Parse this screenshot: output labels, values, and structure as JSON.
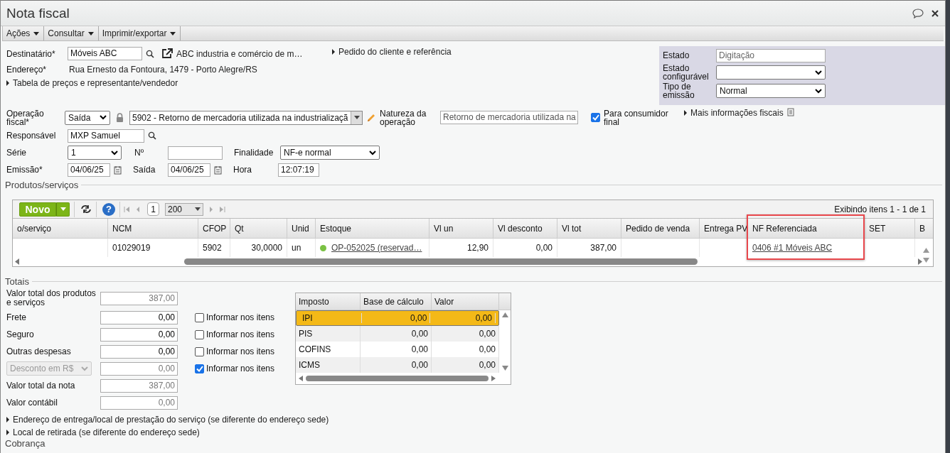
{
  "window": {
    "title": "Nota fiscal"
  },
  "menu": [
    {
      "label": "Ações"
    },
    {
      "label": "Consultar"
    },
    {
      "label": "Imprimir/exportar"
    }
  ],
  "destinatario": {
    "label": "Destinatário*",
    "value": "Móveis ABC",
    "company": "ABC industria e comércio de m…"
  },
  "endereco": {
    "label": "Endereço*",
    "value": "Rua Ernesto da Fontoura, 1479 - Porto Alegre/RS"
  },
  "expanders_top": [
    {
      "label": "Pedido do cliente e referência",
      "expanded": false
    },
    {
      "label": "Tabela de preços e representante/vendedor",
      "expanded": false
    }
  ],
  "status_panel": [
    {
      "label": "Estado",
      "kind": "readonly",
      "value": "Digitação"
    },
    {
      "label": "Estado configurável",
      "kind": "select"
    },
    {
      "label": "Tipo de emissão",
      "kind": "select",
      "value": "Normal"
    }
  ],
  "operacao": {
    "label": "Operação fiscal*",
    "direction": "Saída",
    "locked": true,
    "cfop": "5902 - Retorno de mercadoria utilizada na industrializaçã"
  },
  "natureza": {
    "label": "Natureza da operação",
    "value": "Retorno de mercadoria utilizada na"
  },
  "consumidor_final": {
    "label": "Para consumidor final",
    "checked": true
  },
  "mais_info": {
    "label": "Mais informações fiscais",
    "expanded": false
  },
  "responsavel": {
    "label": "Responsável",
    "value": "MXP Samuel"
  },
  "serie": {
    "label": "Série",
    "value": "1"
  },
  "numero": {
    "label": "Nº"
  },
  "finalidade": {
    "label": "Finalidade",
    "value": "NF-e normal"
  },
  "emissao": {
    "label": "Emissão*",
    "value": "04/06/25"
  },
  "saida": {
    "label": "Saída",
    "value": "04/06/25"
  },
  "hora": {
    "label": "Hora",
    "value": "12:07:19"
  },
  "produtos": {
    "title": "Produtos/serviços",
    "new_button": "Novo",
    "help_glyph": "?",
    "page": "1",
    "page_size": "200",
    "status": "Exibindo itens 1 - 1 de 1",
    "columns": [
      {
        "label": "o/serviço"
      },
      {
        "label": "NCM"
      },
      {
        "label": "CFOP"
      },
      {
        "label": "Qt"
      },
      {
        "label": "Unid"
      },
      {
        "label": "Estoque"
      },
      {
        "label": "Vl un"
      },
      {
        "label": "Vl desconto"
      },
      {
        "label": "Vl tot"
      },
      {
        "label": "Pedido de venda"
      },
      {
        "label": "Entrega PV"
      },
      {
        "label": "NF Referenciada",
        "highlighted": true
      },
      {
        "label": "SET"
      },
      {
        "label": "B"
      }
    ],
    "rows": [
      [
        null,
        {
          "text": "01029019"
        },
        {
          "text": "5902"
        },
        {
          "text": "30,0000"
        },
        {
          "text": "un"
        },
        {
          "text": "OP-052025 (reservad…",
          "link": true,
          "color": "#7ac143"
        },
        {
          "text": "12,90"
        },
        {
          "text": "0,00"
        },
        {
          "text": "387,00"
        },
        null,
        null,
        {
          "text": "0406 #1 Móveis ABC",
          "link": true
        },
        null,
        null
      ]
    ]
  },
  "totais": {
    "title": "Totais",
    "items": [
      {
        "label": "Valor total dos produtos e serviços",
        "value": "387,00",
        "readonly": true
      },
      {
        "label": "Frete",
        "value": "0,00",
        "readonly": false,
        "informar": {
          "label": "Informar nos itens",
          "checked": false
        }
      },
      {
        "label": "Seguro",
        "value": "0,00",
        "readonly": false,
        "informar": {
          "label": "Informar nos itens",
          "checked": false
        }
      },
      {
        "label": "Outras despesas",
        "value": "0,00",
        "readonly": false,
        "informar": {
          "label": "Informar nos itens",
          "checked": false
        }
      },
      {
        "label": "Desconto em R$",
        "kind": "select",
        "value": "0,00",
        "readonly": true,
        "informar": {
          "label": "Informar nos itens",
          "checked": true
        }
      },
      {
        "label": "Valor total da nota",
        "value": "387,00",
        "readonly": true
      },
      {
        "label": "Valor contábil",
        "value": "0,00",
        "readonly": true
      }
    ],
    "tax_columns": [
      "Imposto",
      "Base de cálculo",
      "Valor"
    ],
    "taxes": [
      {
        "name": "IPI",
        "base": "0,00",
        "value": "0,00",
        "selected": true
      },
      {
        "name": "PIS",
        "base": "0,00",
        "value": "0,00",
        "selected": false
      },
      {
        "name": "COFINS",
        "base": "0,00",
        "value": "0,00",
        "selected": false
      },
      {
        "name": "ICMS",
        "base": "0,00",
        "value": "0,00",
        "selected": false
      }
    ]
  },
  "expanders_bottom": [
    {
      "label": "Endereço de entrega/local de prestação do serviço (se diferente do endereço sede)",
      "expanded": false
    },
    {
      "label": "Local de retirada (se diferente do endereço sede)",
      "expanded": false
    }
  ],
  "next_section": "Cobrança"
}
